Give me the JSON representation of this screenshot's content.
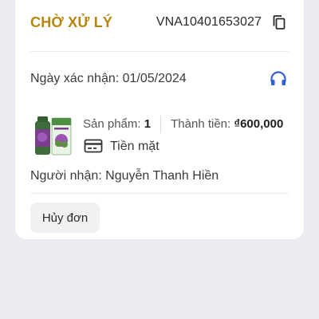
{
  "order": {
    "status": "CHỜ XỬ LÝ",
    "order_id": "VNA10401653027",
    "confirm_date": "Ngày xác nhận: 01/05/2024",
    "product_count_label": "Sản phẩm:",
    "product_count": "1",
    "total_label": "Thành tiền:",
    "total": "₫600,000",
    "payment_method": "Tiền mặt",
    "recipient": "Người nhận: Nguyễn Thanh Hiền",
    "cancel_label": "Hủy đơn"
  },
  "icons": {
    "copy": "copy-icon",
    "support": "headset-icon",
    "payment": "credit-card-icon"
  },
  "colors": {
    "status": "#b8860b",
    "support": "#2f5fd3",
    "background": "#ecebf2"
  }
}
